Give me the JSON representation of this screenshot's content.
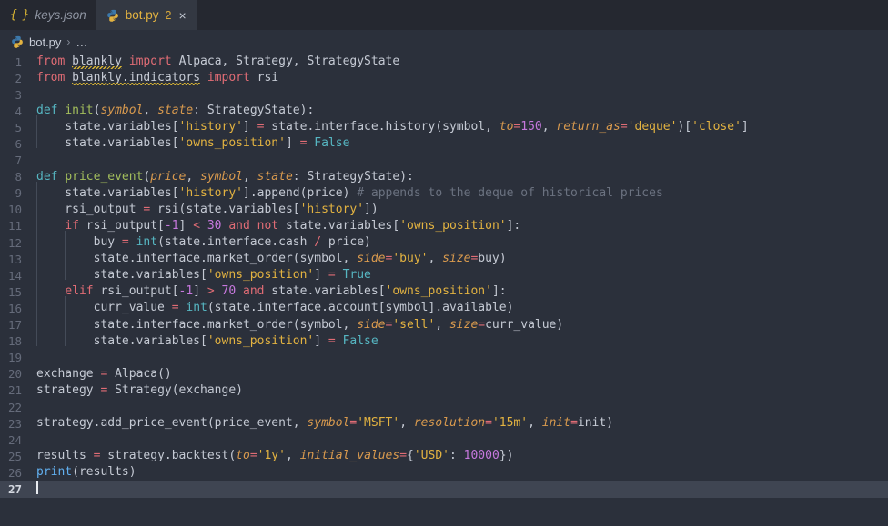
{
  "tabs": [
    {
      "label": "keys.json",
      "icon": "json-braces-icon",
      "state": "inactive",
      "badge": "",
      "close": ""
    },
    {
      "label": "bot.py",
      "icon": "python-icon",
      "state": "active",
      "badge": "2",
      "close": "×"
    }
  ],
  "breadcrumb": {
    "file": "bot.py",
    "separator": "›",
    "overflow": "…",
    "icon": "python-icon"
  },
  "editor": {
    "language": "python",
    "cursor_line": 27,
    "total_lines": 27,
    "lines": [
      {
        "n": "1",
        "tokens": [
          {
            "t": "from ",
            "c": "kw"
          },
          {
            "t": "blankly",
            "c": "pl sq"
          },
          {
            "t": " ",
            "c": "pl"
          },
          {
            "t": "import ",
            "c": "kw"
          },
          {
            "t": "Alpaca, Strategy, StrategyState",
            "c": "pl"
          }
        ]
      },
      {
        "n": "2",
        "tokens": [
          {
            "t": "from ",
            "c": "kw"
          },
          {
            "t": "blankly.indicators",
            "c": "pl sq"
          },
          {
            "t": " ",
            "c": "pl"
          },
          {
            "t": "import ",
            "c": "kw"
          },
          {
            "t": "rsi",
            "c": "pl"
          }
        ]
      },
      {
        "n": "3",
        "tokens": []
      },
      {
        "n": "4",
        "tokens": [
          {
            "t": "def ",
            "c": "def"
          },
          {
            "t": "init",
            "c": "fn"
          },
          {
            "t": "(",
            "c": "pl"
          },
          {
            "t": "symbol",
            "c": "par"
          },
          {
            "t": ", ",
            "c": "pl"
          },
          {
            "t": "state",
            "c": "par"
          },
          {
            "t": ": StrategyState):",
            "c": "pl"
          }
        ]
      },
      {
        "n": "5",
        "indent": 1,
        "tokens": [
          {
            "t": "    state.variables[",
            "c": "pl"
          },
          {
            "t": "'history'",
            "c": "str"
          },
          {
            "t": "] ",
            "c": "pl"
          },
          {
            "t": "=",
            "c": "op"
          },
          {
            "t": " state.interface.history(symbol, ",
            "c": "pl"
          },
          {
            "t": "to",
            "c": "par"
          },
          {
            "t": "=",
            "c": "op"
          },
          {
            "t": "150",
            "c": "num"
          },
          {
            "t": ", ",
            "c": "pl"
          },
          {
            "t": "return_as",
            "c": "par"
          },
          {
            "t": "=",
            "c": "op"
          },
          {
            "t": "'deque'",
            "c": "str"
          },
          {
            "t": ")[",
            "c": "pl"
          },
          {
            "t": "'close'",
            "c": "str"
          },
          {
            "t": "]",
            "c": "pl"
          }
        ]
      },
      {
        "n": "6",
        "indent": 1,
        "tokens": [
          {
            "t": "    state.variables[",
            "c": "pl"
          },
          {
            "t": "'owns_position'",
            "c": "str"
          },
          {
            "t": "] ",
            "c": "pl"
          },
          {
            "t": "=",
            "c": "op"
          },
          {
            "t": " ",
            "c": "pl"
          },
          {
            "t": "False",
            "c": "cst"
          }
        ]
      },
      {
        "n": "7",
        "tokens": []
      },
      {
        "n": "8",
        "tokens": [
          {
            "t": "def ",
            "c": "def"
          },
          {
            "t": "price_event",
            "c": "fn"
          },
          {
            "t": "(",
            "c": "pl"
          },
          {
            "t": "price",
            "c": "par"
          },
          {
            "t": ", ",
            "c": "pl"
          },
          {
            "t": "symbol",
            "c": "par"
          },
          {
            "t": ", ",
            "c": "pl"
          },
          {
            "t": "state",
            "c": "par"
          },
          {
            "t": ": StrategyState):",
            "c": "pl"
          }
        ]
      },
      {
        "n": "9",
        "indent": 1,
        "tokens": [
          {
            "t": "    state.variables[",
            "c": "pl"
          },
          {
            "t": "'history'",
            "c": "str"
          },
          {
            "t": "].append(price) ",
            "c": "pl"
          },
          {
            "t": "# appends to the deque of historical prices",
            "c": "cmt"
          }
        ]
      },
      {
        "n": "10",
        "indent": 1,
        "tokens": [
          {
            "t": "    rsi_output ",
            "c": "pl"
          },
          {
            "t": "=",
            "c": "op"
          },
          {
            "t": " rsi(state.variables[",
            "c": "pl"
          },
          {
            "t": "'history'",
            "c": "str"
          },
          {
            "t": "])",
            "c": "pl"
          }
        ]
      },
      {
        "n": "11",
        "indent": 1,
        "tokens": [
          {
            "t": "    ",
            "c": "pl"
          },
          {
            "t": "if",
            "c": "kw"
          },
          {
            "t": " rsi_output[",
            "c": "pl"
          },
          {
            "t": "-1",
            "c": "num"
          },
          {
            "t": "] ",
            "c": "pl"
          },
          {
            "t": "<",
            "c": "op"
          },
          {
            "t": " ",
            "c": "pl"
          },
          {
            "t": "30",
            "c": "num"
          },
          {
            "t": " ",
            "c": "pl"
          },
          {
            "t": "and not",
            "c": "kw"
          },
          {
            "t": " state.variables[",
            "c": "pl"
          },
          {
            "t": "'owns_position'",
            "c": "str"
          },
          {
            "t": "]:",
            "c": "pl"
          }
        ]
      },
      {
        "n": "12",
        "indent": 2,
        "tokens": [
          {
            "t": "        buy ",
            "c": "pl"
          },
          {
            "t": "=",
            "c": "op"
          },
          {
            "t": " ",
            "c": "pl"
          },
          {
            "t": "int",
            "c": "bi"
          },
          {
            "t": "(state.interface.cash ",
            "c": "pl"
          },
          {
            "t": "/",
            "c": "op"
          },
          {
            "t": " price)",
            "c": "pl"
          }
        ]
      },
      {
        "n": "13",
        "indent": 2,
        "tokens": [
          {
            "t": "        state.interface.market_order(symbol, ",
            "c": "pl"
          },
          {
            "t": "side",
            "c": "par"
          },
          {
            "t": "=",
            "c": "op"
          },
          {
            "t": "'buy'",
            "c": "str"
          },
          {
            "t": ", ",
            "c": "pl"
          },
          {
            "t": "size",
            "c": "par"
          },
          {
            "t": "=",
            "c": "op"
          },
          {
            "t": "buy)",
            "c": "pl"
          }
        ]
      },
      {
        "n": "14",
        "indent": 2,
        "tokens": [
          {
            "t": "        state.variables[",
            "c": "pl"
          },
          {
            "t": "'owns_position'",
            "c": "str"
          },
          {
            "t": "] ",
            "c": "pl"
          },
          {
            "t": "=",
            "c": "op"
          },
          {
            "t": " ",
            "c": "pl"
          },
          {
            "t": "True",
            "c": "cst"
          }
        ]
      },
      {
        "n": "15",
        "indent": 1,
        "tokens": [
          {
            "t": "    ",
            "c": "pl"
          },
          {
            "t": "elif",
            "c": "kw"
          },
          {
            "t": " rsi_output[",
            "c": "pl"
          },
          {
            "t": "-1",
            "c": "num"
          },
          {
            "t": "] ",
            "c": "pl"
          },
          {
            "t": ">",
            "c": "op"
          },
          {
            "t": " ",
            "c": "pl"
          },
          {
            "t": "70",
            "c": "num"
          },
          {
            "t": " ",
            "c": "pl"
          },
          {
            "t": "and",
            "c": "kw"
          },
          {
            "t": " state.variables[",
            "c": "pl"
          },
          {
            "t": "'owns_position'",
            "c": "str"
          },
          {
            "t": "]:",
            "c": "pl"
          }
        ]
      },
      {
        "n": "16",
        "indent": 2,
        "tokens": [
          {
            "t": "        curr_value ",
            "c": "pl"
          },
          {
            "t": "=",
            "c": "op"
          },
          {
            "t": " ",
            "c": "pl"
          },
          {
            "t": "int",
            "c": "bi"
          },
          {
            "t": "(state.interface.account[symbol].available)",
            "c": "pl"
          }
        ]
      },
      {
        "n": "17",
        "indent": 2,
        "tokens": [
          {
            "t": "        state.interface.market_order(symbol, ",
            "c": "pl"
          },
          {
            "t": "side",
            "c": "par"
          },
          {
            "t": "=",
            "c": "op"
          },
          {
            "t": "'sell'",
            "c": "str"
          },
          {
            "t": ", ",
            "c": "pl"
          },
          {
            "t": "size",
            "c": "par"
          },
          {
            "t": "=",
            "c": "op"
          },
          {
            "t": "curr_value)",
            "c": "pl"
          }
        ]
      },
      {
        "n": "18",
        "indent": 2,
        "tokens": [
          {
            "t": "        state.variables[",
            "c": "pl"
          },
          {
            "t": "'owns_position'",
            "c": "str"
          },
          {
            "t": "] ",
            "c": "pl"
          },
          {
            "t": "=",
            "c": "op"
          },
          {
            "t": " ",
            "c": "pl"
          },
          {
            "t": "False",
            "c": "cst"
          }
        ]
      },
      {
        "n": "19",
        "tokens": []
      },
      {
        "n": "20",
        "tokens": [
          {
            "t": "exchange ",
            "c": "pl"
          },
          {
            "t": "=",
            "c": "op"
          },
          {
            "t": " Alpaca()",
            "c": "pl"
          }
        ]
      },
      {
        "n": "21",
        "tokens": [
          {
            "t": "strategy ",
            "c": "pl"
          },
          {
            "t": "=",
            "c": "op"
          },
          {
            "t": " Strategy(exchange)",
            "c": "pl"
          }
        ]
      },
      {
        "n": "22",
        "tokens": []
      },
      {
        "n": "23",
        "tokens": [
          {
            "t": "strategy.add_price_event(price_event, ",
            "c": "pl"
          },
          {
            "t": "symbol",
            "c": "par"
          },
          {
            "t": "=",
            "c": "op"
          },
          {
            "t": "'MSFT'",
            "c": "str"
          },
          {
            "t": ", ",
            "c": "pl"
          },
          {
            "t": "resolution",
            "c": "par"
          },
          {
            "t": "=",
            "c": "op"
          },
          {
            "t": "'15m'",
            "c": "str"
          },
          {
            "t": ", ",
            "c": "pl"
          },
          {
            "t": "init",
            "c": "par"
          },
          {
            "t": "=",
            "c": "op"
          },
          {
            "t": "init)",
            "c": "pl"
          }
        ]
      },
      {
        "n": "24",
        "tokens": []
      },
      {
        "n": "25",
        "tokens": [
          {
            "t": "results ",
            "c": "pl"
          },
          {
            "t": "=",
            "c": "op"
          },
          {
            "t": " strategy.backtest(",
            "c": "pl"
          },
          {
            "t": "to",
            "c": "par"
          },
          {
            "t": "=",
            "c": "op"
          },
          {
            "t": "'1y'",
            "c": "str"
          },
          {
            "t": ", ",
            "c": "pl"
          },
          {
            "t": "initial_values",
            "c": "par"
          },
          {
            "t": "=",
            "c": "op"
          },
          {
            "t": "{",
            "c": "pl"
          },
          {
            "t": "'USD'",
            "c": "str"
          },
          {
            "t": ": ",
            "c": "pl"
          },
          {
            "t": "10000",
            "c": "num"
          },
          {
            "t": "})",
            "c": "pl"
          }
        ]
      },
      {
        "n": "26",
        "tokens": [
          {
            "t": "print",
            "c": "fnc"
          },
          {
            "t": "(results)",
            "c": "pl"
          }
        ]
      },
      {
        "n": "27",
        "active": true,
        "cursor": true,
        "tokens": []
      }
    ]
  },
  "colors": {
    "editor_bg": "#2b303b",
    "tabbar_bg": "#252830",
    "active_tab_bg": "#333842",
    "active_line_bg": "#3f4552",
    "keyword": "#e06c75",
    "string": "#e3b341",
    "number": "#c678dd",
    "comment": "#6b7280",
    "function": "#a3be5c",
    "builtin": "#56b6c2",
    "parameter": "#d99a4e",
    "plain": "#c5cad4",
    "linenumber": "#656b7a",
    "warning_squiggle": "#d8b434"
  }
}
